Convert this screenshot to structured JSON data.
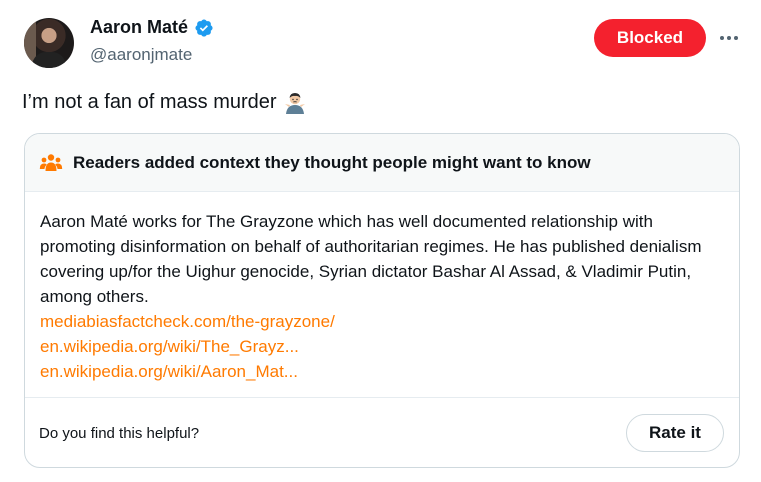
{
  "author": {
    "display_name": "Aaron Maté",
    "handle": "@aaronjmate",
    "verified": true,
    "verified_color": "#1d9bf0"
  },
  "actions": {
    "blocked_label": "Blocked",
    "blocked_color": "#f4212e",
    "more_icon": "more-horizontal-icon"
  },
  "tweet": {
    "text": "I’m not a fan of mass murder",
    "emoji": "person-shrugging-emoji"
  },
  "community_note": {
    "header": "Readers added context they thought people might want to know",
    "header_icon": "people-icon",
    "accent_color": "#ff7a00",
    "body": "Aaron Maté works for The Grayzone which has well documented relationship with promoting disinformation on behalf of authoritarian regimes. He has published denialism covering up/for the Uighur genocide, Syrian dictator Bashar Al Assad, & Vladimir Putin, among others.",
    "links": [
      "mediabiasfactcheck.com/the-grayzone/",
      "en.wikipedia.org/wiki/The_Grayz...",
      "en.wikipedia.org/wiki/Aaron_Mat..."
    ],
    "helpful_question": "Do you find this helpful?",
    "rate_label": "Rate it"
  }
}
